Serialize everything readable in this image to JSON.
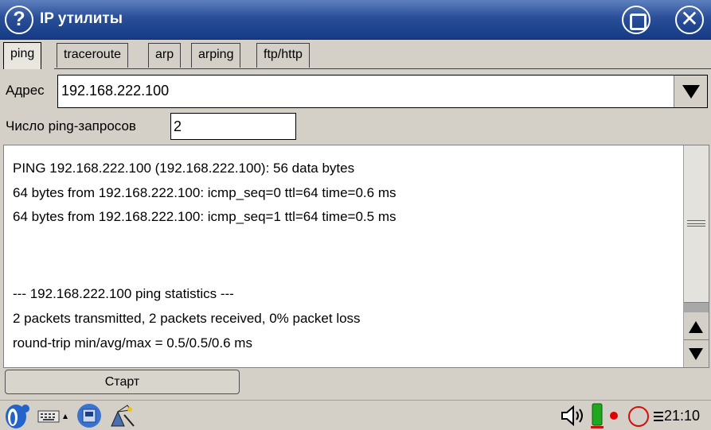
{
  "window": {
    "title": "IP утилиты"
  },
  "tabs": [
    {
      "label": "ping",
      "active": true
    },
    {
      "label": "traceroute",
      "active": false
    },
    {
      "label": "arp",
      "active": false
    },
    {
      "label": "arping",
      "active": false
    },
    {
      "label": "ftp/http",
      "active": false
    }
  ],
  "form": {
    "address_label": "Адрес",
    "address_value": "192.168.222.100",
    "count_label": "Число ping-запросов",
    "count_value": "2"
  },
  "output": {
    "lines": [
      "PING 192.168.222.100 (192.168.222.100): 56 data bytes",
      "64 bytes from 192.168.222.100: icmp_seq=0 ttl=64 time=0.6 ms",
      "64 bytes from 192.168.222.100: icmp_seq=1 ttl=64 time=0.5 ms",
      "",
      "",
      "--- 192.168.222.100 ping statistics ---",
      "2 packets transmitted, 2 packets received, 0% packet loss",
      "round-trip min/avg/max = 0.5/0.5/0.6 ms"
    ]
  },
  "actions": {
    "start_label": "Старт"
  },
  "taskbar": {
    "clock": "21:10",
    "icons": [
      "start-menu-icon",
      "keyboard-icon",
      "app-icon",
      "wizard-icon",
      "speaker-icon",
      "battery-icon",
      "record-indicator-icon",
      "status-circle-icon",
      "menu-icon"
    ]
  },
  "colors": {
    "titlebar": "#2a4f98",
    "record": "#e00000",
    "battery": "#1fa81f"
  }
}
